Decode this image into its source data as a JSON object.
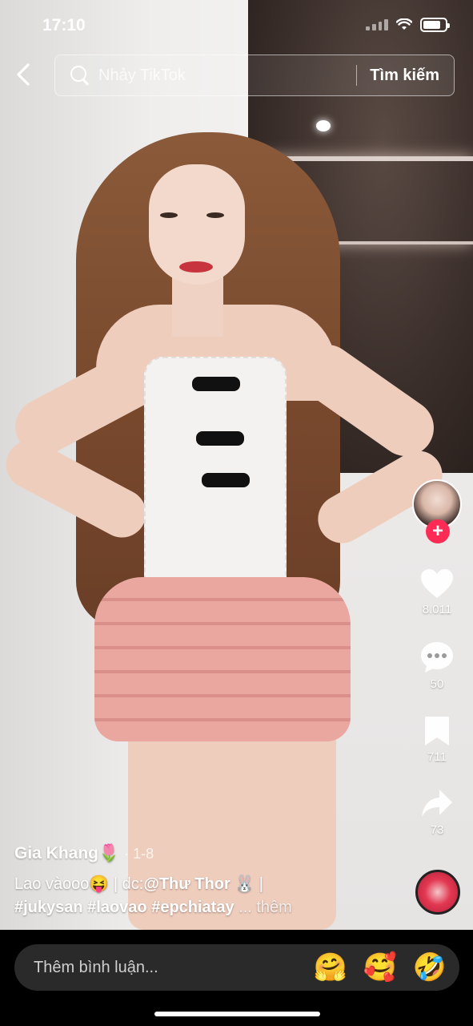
{
  "status_bar": {
    "time": "17:10"
  },
  "search": {
    "placeholder": "Nhảy TikTok",
    "button_label": "Tìm kiếm"
  },
  "rail": {
    "follow_label": "+",
    "likes": "8.011",
    "comments": "50",
    "saves": "711",
    "shares": "73"
  },
  "caption": {
    "author": "Gia Khang🌷",
    "date": "· 1-8",
    "text_prefix": "Lao vàooo😝 | dc:",
    "mention": "@Thư Thor 🐰",
    "text_suffix": " |",
    "hashtags": "#jukysan #laovao #epchiatay",
    "more": " ... thêm"
  },
  "comment_bar": {
    "placeholder": "Thêm bình luận...",
    "emojis": [
      "🤗",
      "🥰",
      "🤣"
    ]
  },
  "colors": {
    "accent": "#fe2c55",
    "background": "#000000"
  }
}
